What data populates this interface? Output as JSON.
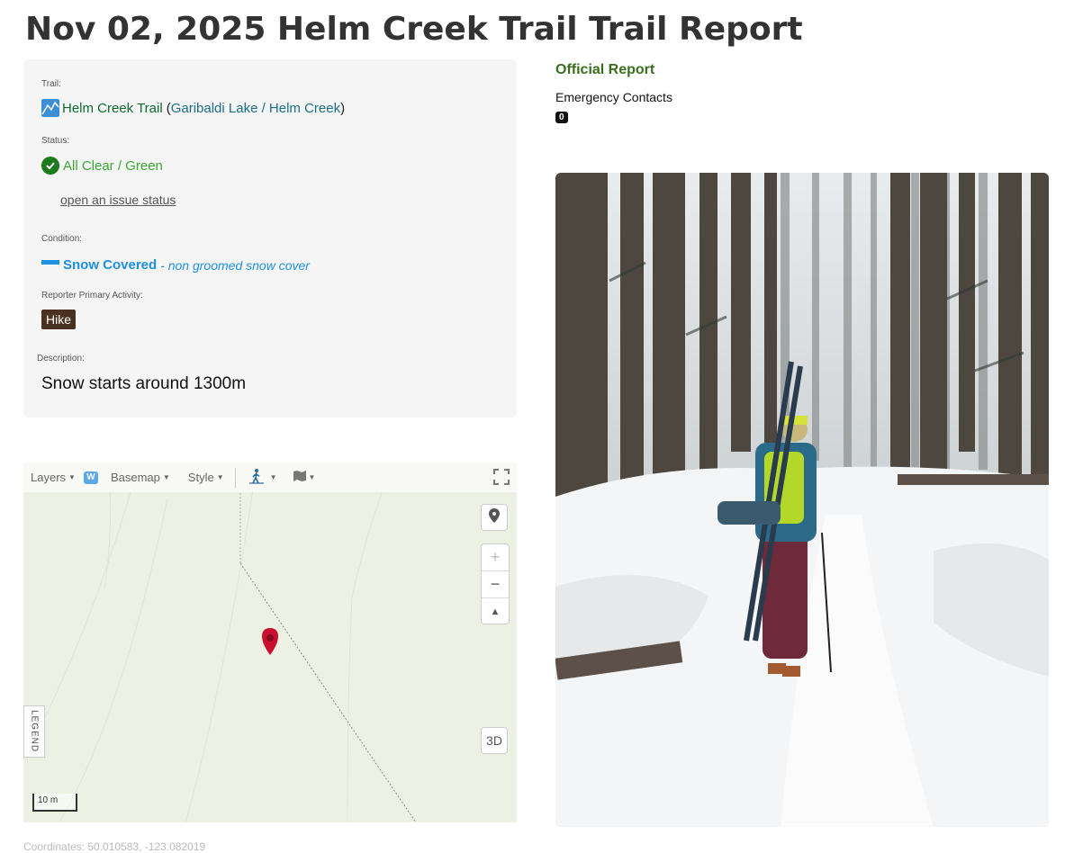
{
  "page": {
    "title": "Nov 02, 2025 Helm Creek Trail Trail Report"
  },
  "info": {
    "trail_label": "Trail:",
    "trail_name": "Helm Creek Trail",
    "trail_area": "Garibaldi Lake / Helm Creek",
    "paren_open": "(",
    "paren_close": ")",
    "status_label": "Status:",
    "status_value": "All Clear / Green",
    "issue_link": "open an issue status",
    "condition_label": "Condition:",
    "condition_value": "Snow Covered",
    "condition_detail": "- non groomed snow cover",
    "activity_label": "Reporter Primary Activity:",
    "activity_value": "Hike",
    "description_label": "Description:",
    "description_value": "Snow starts around 1300m"
  },
  "right": {
    "official_report": "Official Report",
    "emergency_contacts": "Emergency Contacts",
    "emergency_count": "0"
  },
  "map": {
    "layers": "Layers",
    "layers_badge": "W",
    "basemap": "Basemap",
    "style": "Style",
    "btn_3d": "3D",
    "legend": "LEGEND",
    "scale": "10 m",
    "zoom_in": "+",
    "zoom_out": "−",
    "compass": "▲"
  },
  "footer": {
    "coordinates": "Coordinates: 50.010583, -123.082019"
  },
  "colors": {
    "status_green": "#3aa832",
    "condition_blue": "#1e90e0",
    "official_green": "#3a6e1e",
    "hike_brown": "#4a3020",
    "marker_red": "#c8102e"
  },
  "icons": [
    "trail-icon",
    "check-circle-icon",
    "snow-bar-icon",
    "hiker-icon",
    "map-icon",
    "fullscreen-icon",
    "location-pin-icon",
    "map-marker-icon"
  ]
}
